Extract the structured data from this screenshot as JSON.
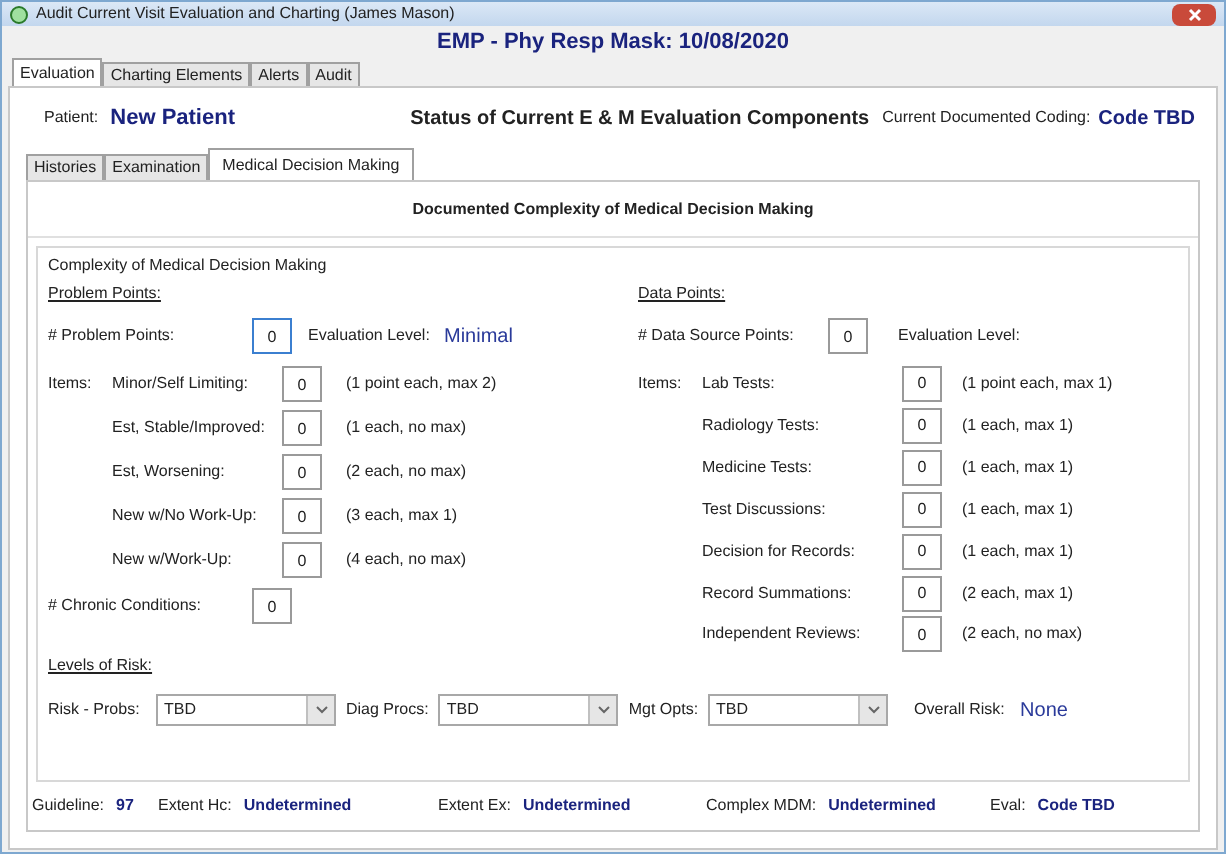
{
  "window": {
    "title": "Audit Current Visit Evaluation and Charting (James Mason)"
  },
  "header": "EMP - Phy Resp Mask: 10/08/2020",
  "tabs": [
    {
      "label": "Evaluation",
      "selected": true
    },
    {
      "label": "Charting Elements",
      "selected": false
    },
    {
      "label": "Alerts",
      "selected": false
    },
    {
      "label": "Audit",
      "selected": false
    }
  ],
  "patient": {
    "label": "Patient:",
    "value": "New Patient"
  },
  "status_title": "Status of Current E & M Evaluation Components",
  "coding": {
    "label": "Current Documented Coding:",
    "value": "Code TBD"
  },
  "subtabs": [
    {
      "label": "Histories",
      "selected": false
    },
    {
      "label": "Examination",
      "selected": false
    },
    {
      "label": "Medical Decision Making",
      "selected": true
    }
  ],
  "section_title": "Documented Complexity of Medical Decision Making",
  "group_title": "Complexity of Medical Decision Making",
  "problem": {
    "heading": "Problem Points:",
    "points_label": "# Problem Points:",
    "points_value": "0",
    "eval_label": "Evaluation Level:",
    "eval_value": "Minimal",
    "items_label": "Items:",
    "items": [
      {
        "label": "Minor/Self Limiting:",
        "value": "0",
        "note": "(1 point each, max 2)"
      },
      {
        "label": "Est, Stable/Improved:",
        "value": "0",
        "note": "(1 each, no max)"
      },
      {
        "label": "Est, Worsening:",
        "value": "0",
        "note": "(2 each, no max)"
      },
      {
        "label": "New w/No Work-Up:",
        "value": "0",
        "note": "(3 each, max 1)"
      },
      {
        "label": "New w/Work-Up:",
        "value": "0",
        "note": "(4 each, no max)"
      }
    ],
    "chronic_label": "# Chronic Conditions:",
    "chronic_value": "0"
  },
  "data": {
    "heading": "Data Points:",
    "points_label": "# Data Source Points:",
    "points_value": "0",
    "eval_label": "Evaluation Level:",
    "items_label": "Items:",
    "items": [
      {
        "label": "Lab Tests:",
        "value": "0",
        "note": "(1 point each, max 1)"
      },
      {
        "label": "Radiology Tests:",
        "value": "0",
        "note": "(1 each, max 1)"
      },
      {
        "label": "Medicine Tests:",
        "value": "0",
        "note": "(1 each, max 1)"
      },
      {
        "label": "Test Discussions:",
        "value": "0",
        "note": "(1 each, max 1)"
      },
      {
        "label": "Decision for Records:",
        "value": "0",
        "note": "(1 each, max 1)"
      },
      {
        "label": "Record Summations:",
        "value": "0",
        "note": "(2 each, max 1)"
      },
      {
        "label": "Independent Reviews:",
        "value": "0",
        "note": "(2 each, no max)"
      }
    ]
  },
  "risk": {
    "heading": "Levels of Risk:",
    "selects": [
      {
        "label": "Risk -  Probs:",
        "value": "TBD"
      },
      {
        "label": "Diag Procs:",
        "value": "TBD"
      },
      {
        "label": "Mgt Opts:",
        "value": "TBD"
      }
    ],
    "overall_label": "Overall Risk:",
    "overall_value": "None"
  },
  "status_bar": [
    {
      "label": "Guideline:",
      "value": "97"
    },
    {
      "label": "Extent Hc:",
      "value": "Undetermined"
    },
    {
      "label": "Extent Ex:",
      "value": "Undetermined"
    },
    {
      "label": "Complex MDM:",
      "value": "Undetermined"
    },
    {
      "label": "Eval:",
      "value": "Code TBD"
    }
  ]
}
